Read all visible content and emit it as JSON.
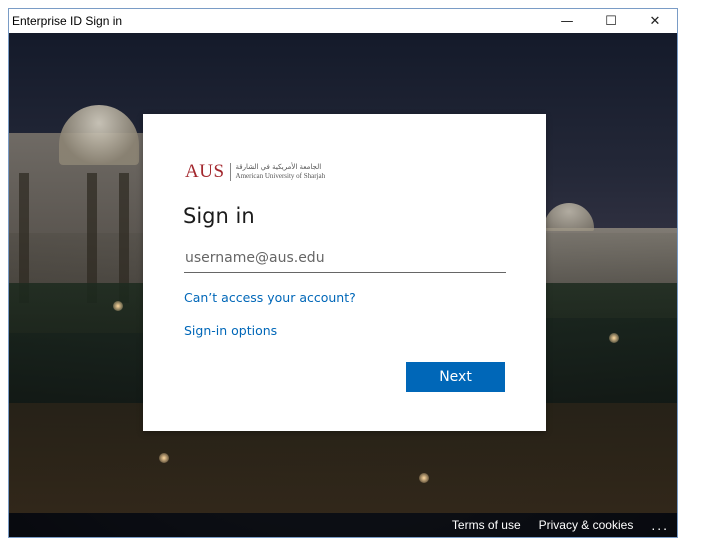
{
  "window": {
    "title": "Enterprise ID Sign in",
    "minimize_glyph": "—",
    "maximize_glyph": "☐",
    "close_glyph": "✕"
  },
  "logo": {
    "abbr": "AUS",
    "arabic": "الجامعة الأمريكية في الشارقة",
    "english": "American University of Sharjah",
    "brand_color": "#a3272d"
  },
  "signin": {
    "heading": "Sign in",
    "username_placeholder": "username@aus.edu",
    "username_value": "",
    "cant_access_link": "Can’t access your account?",
    "options_link": "Sign-in options",
    "next_button": "Next",
    "accent_color": "#0067b8"
  },
  "footer": {
    "terms": "Terms of use",
    "privacy": "Privacy & cookies",
    "more": "..."
  }
}
